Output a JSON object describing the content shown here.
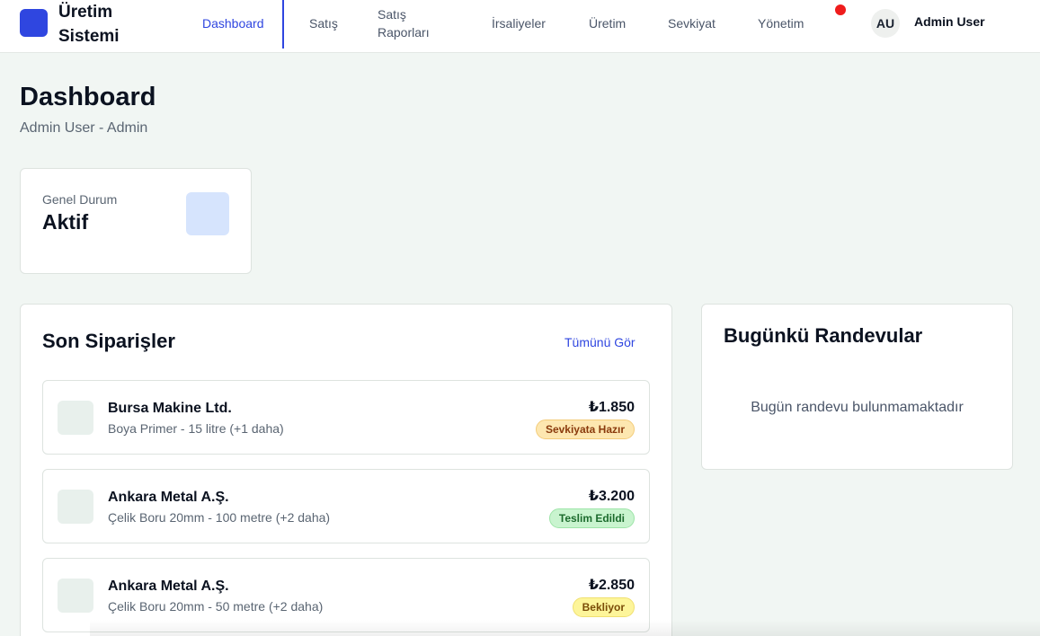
{
  "app": {
    "title": "Üretim Sistemi"
  },
  "nav": {
    "items": [
      {
        "label": "Dashboard"
      },
      {
        "label": "Satış"
      },
      {
        "label": "Satış Raporları"
      },
      {
        "label": "İrsaliyeler"
      },
      {
        "label": "Üretim"
      },
      {
        "label": "Sevkiyat"
      },
      {
        "label": "Yönetim"
      }
    ],
    "active": "Dashboard"
  },
  "user": {
    "initials": "AU",
    "name": "Admin User"
  },
  "page": {
    "title": "Dashboard",
    "subtitle": "Admin User - Admin"
  },
  "status": {
    "label": "Genel Durum",
    "value": "Aktif"
  },
  "orders": {
    "title": "Son Siparişler",
    "view_all": "Tümünü Gör",
    "items": [
      {
        "customer": "Bursa Makine Ltd.",
        "description": "Boya Primer - 15 litre (+1 daha)",
        "amount": "₺1.850",
        "status": "Sevkiyata Hazır"
      },
      {
        "customer": "Ankara Metal A.Ş.",
        "description": "Çelik Boru 20mm - 100 metre (+2 daha)",
        "amount": "₺3.200",
        "status": "Teslim Edildi"
      },
      {
        "customer": "Ankara Metal A.Ş.",
        "description": "Çelik Boru 20mm - 50 metre (+2 daha)",
        "amount": "₺2.850",
        "status": "Bekliyor"
      }
    ]
  },
  "appointments": {
    "title": "Bugünkü Randevular",
    "empty_text": "Bugün randevu bulunmamaktadır"
  },
  "colors": {
    "accent": "#2f46e0",
    "notification": "#ef1c1c",
    "background": "#f1f6f3"
  }
}
